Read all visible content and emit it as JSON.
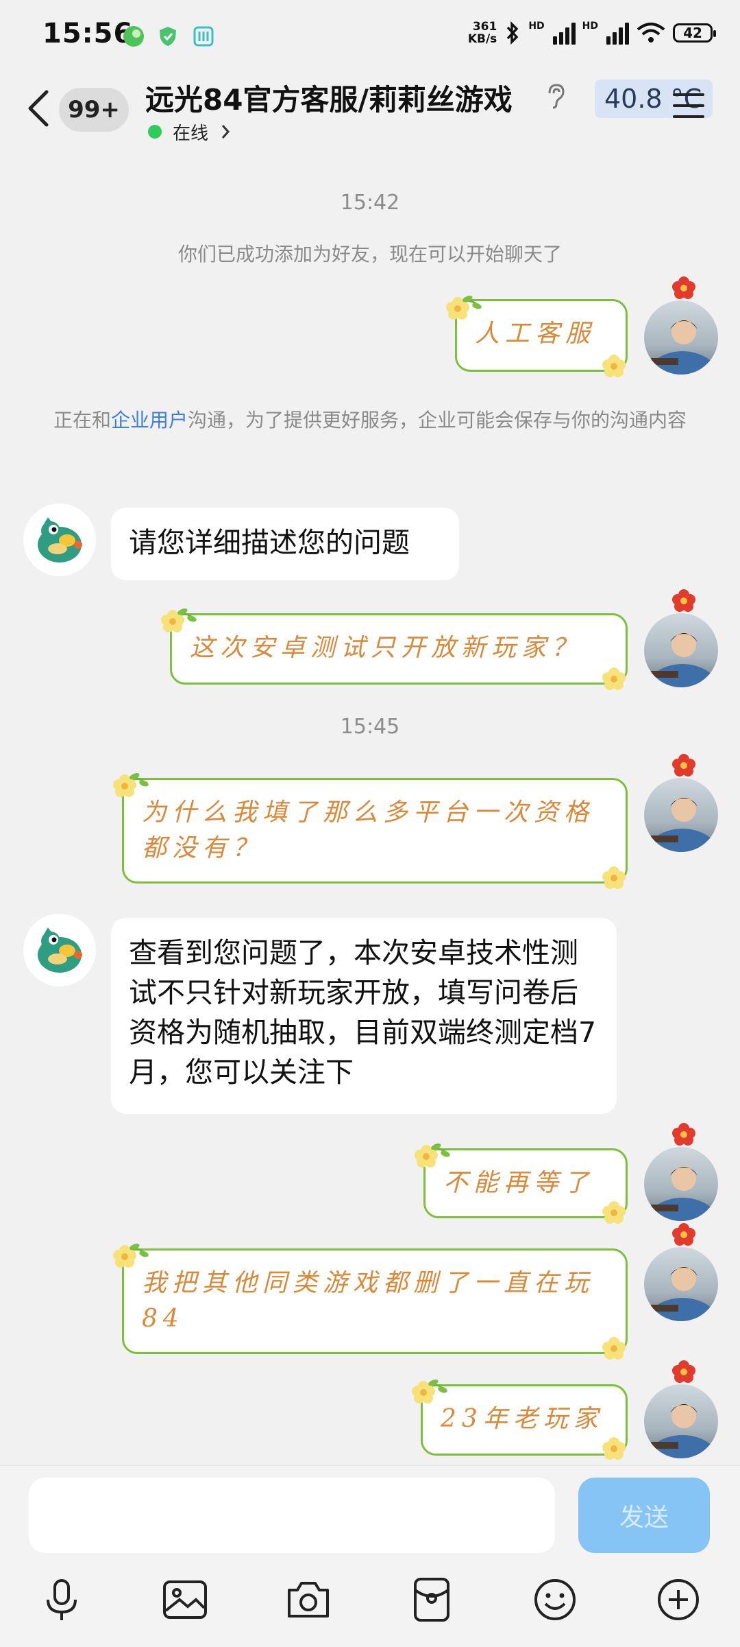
{
  "status_bar": {
    "time": "15:56",
    "net_speed_value": "361",
    "net_speed_unit": "KB/s",
    "battery": "42",
    "hd1": "HD",
    "hd2": "HD"
  },
  "header": {
    "badge": "99+",
    "title": "远光84官方客服/莉莉丝游戏",
    "status": "在线",
    "temperature": "40.8 °C"
  },
  "messages": {
    "ts1": "15:42",
    "sys_added": "你们已成功添加为好友，现在可以开始聊天了",
    "me1": "人工客服",
    "sys_enterprise_pre": "正在和",
    "sys_enterprise_link": "企业用户",
    "sys_enterprise_post": "沟通，为了提供更好服务，企业可能会保存与你的沟通内容",
    "bot1": "请您详细描述您的问题",
    "me2": "这次安卓测试只开放新玩家？",
    "ts2": "15:45",
    "me3": "为什么我填了那么多平台一次资格都没有？",
    "bot2": "查看到您问题了，本次安卓技术性测试不只针对新玩家开放，填写问卷后资格为随机抽取，目前双端终测定档7月，您可以关注下",
    "me4": "不能再等了",
    "me5": "我把其他同类游戏都删了一直在玩84",
    "me6": "23年老玩家"
  },
  "composer": {
    "input_value": "",
    "send_label": "发送"
  },
  "toolbar": [
    "mic-icon",
    "image-icon",
    "camera-icon",
    "red-packet-icon",
    "emoji-icon",
    "plus-icon"
  ],
  "colors": {
    "bubble_border": "#7cbf3a",
    "bubble_text": "#d88a3a",
    "send_bg": "#86c4f6",
    "link": "#3d7fe0",
    "online": "#2ecc58"
  }
}
